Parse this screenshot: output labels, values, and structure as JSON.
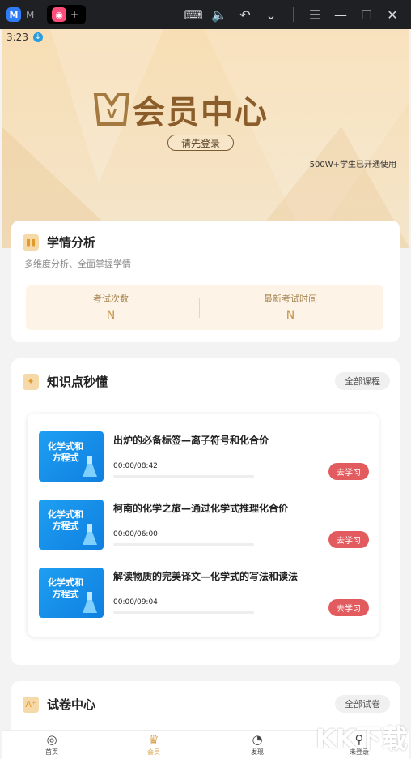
{
  "titlebar": {
    "tabs": [
      {
        "label": "M",
        "icon": "app-icon-blue"
      },
      {
        "label": "+",
        "icon": "app-icon-pink"
      }
    ],
    "controls": [
      "keyboard-icon",
      "volume-icon",
      "undo-icon",
      "chevron-down-icon",
      "menu-icon",
      "minimize-icon",
      "maximize-icon",
      "close-icon"
    ]
  },
  "status": {
    "time": "3:23"
  },
  "hero": {
    "title": "会员中心",
    "login_label": "请先登录",
    "subtitle": "500W+学生已开通使用"
  },
  "analysis": {
    "title": "学情分析",
    "desc": "多维度分析、全面掌握学情",
    "stats": [
      {
        "label": "考试次数",
        "value": "N"
      },
      {
        "label": "最新考试时间",
        "value": "N"
      }
    ]
  },
  "knowledge": {
    "title": "知识点秒懂",
    "all_label": "全部课程",
    "courses": [
      {
        "thumb": "化学式和方程式",
        "title": "出炉的必备标签—离子符号和化合价",
        "time": "00:00/08:42",
        "progress": 0,
        "btn": "去学习"
      },
      {
        "thumb": "化学式和方程式",
        "title": "柯南的化学之旅—通过化学式推理化合价",
        "time": "00:00/06:00",
        "progress": 0,
        "btn": "去学习"
      },
      {
        "thumb": "化学式和方程式",
        "title": "解读物质的完美译文—化学式的写法和读法",
        "time": "00:00/09:04",
        "progress": 0,
        "btn": "去学习"
      }
    ]
  },
  "paper": {
    "title": "试卷中心",
    "all_label": "全部试卷"
  },
  "nav": [
    {
      "label": "首页",
      "icon": "home-icon"
    },
    {
      "label": "会员",
      "icon": "crown-icon"
    },
    {
      "label": "发现",
      "icon": "discover-icon"
    },
    {
      "label": "未登录",
      "icon": "user-icon"
    }
  ],
  "watermark": "KK下载",
  "colors": {
    "gold": "#c8954a",
    "accent_red": "#e25b5f",
    "blue": "#1e9ff2"
  }
}
